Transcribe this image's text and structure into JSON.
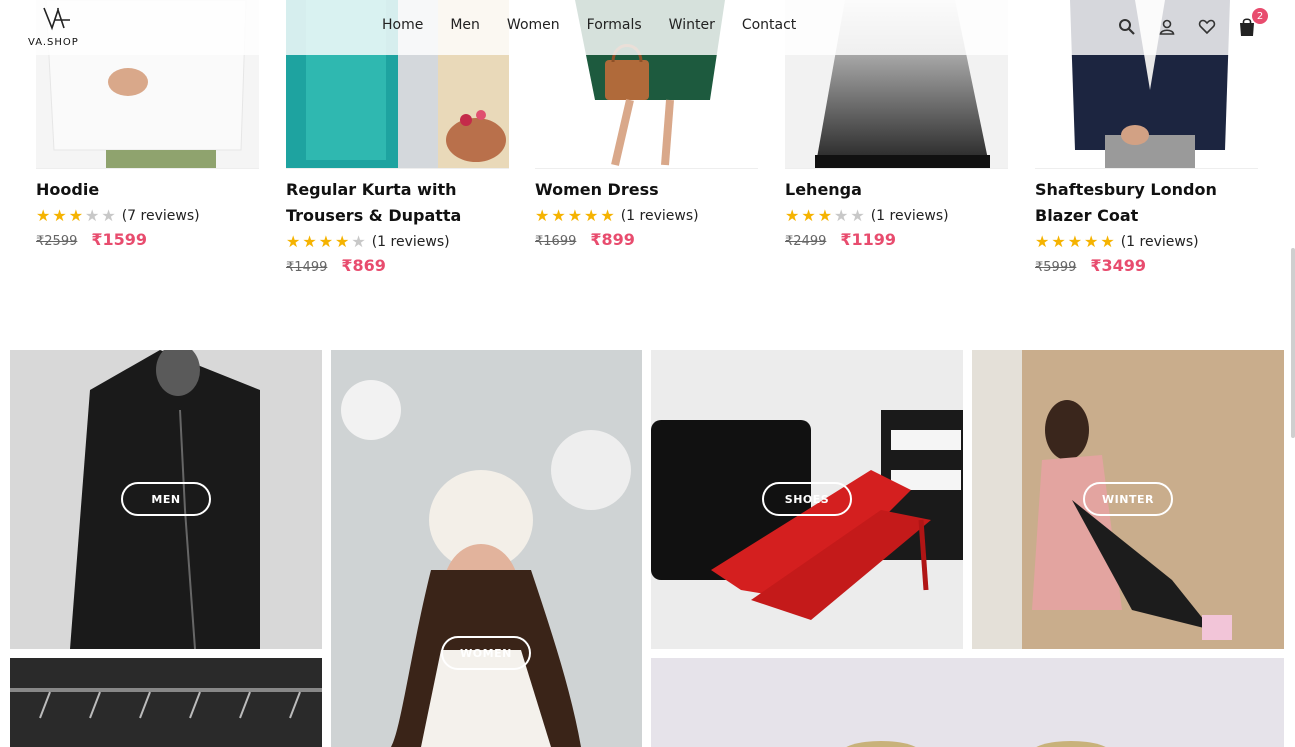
{
  "header": {
    "logo_text": "VA.SHOP",
    "nav": [
      "Home",
      "Men",
      "Women",
      "Formals",
      "Winter",
      "Contact"
    ],
    "cart_count": "2",
    "icons": [
      "search-icon",
      "user-icon",
      "heart-icon",
      "cart-icon"
    ]
  },
  "products": [
    {
      "name": "Hoodie",
      "rating": 3,
      "reviews": "(7 reviews)",
      "old_price": "₹2599",
      "price": "₹1599"
    },
    {
      "name": "Regular Kurta with Trousers & Dupatta",
      "rating": 4,
      "reviews": "(1 reviews)",
      "old_price": "₹1499",
      "price": "₹869"
    },
    {
      "name": "Women Dress",
      "rating": 5,
      "reviews": "(1 reviews)",
      "old_price": "₹1699",
      "price": "₹899"
    },
    {
      "name": "Lehenga",
      "rating": 3,
      "reviews": "(1 reviews)",
      "old_price": "₹2499",
      "price": "₹1199"
    },
    {
      "name": "Shaftesbury London Blazer Coat",
      "rating": 5,
      "reviews": "(1 reviews)",
      "old_price": "₹5999",
      "price": "₹3499"
    }
  ],
  "categories": {
    "men": "MEN",
    "women": "WOMEN",
    "shoes": "SHOES",
    "winter": "WINTER"
  },
  "colors": {
    "accent": "#e84c6e",
    "star": "#f5b301"
  }
}
